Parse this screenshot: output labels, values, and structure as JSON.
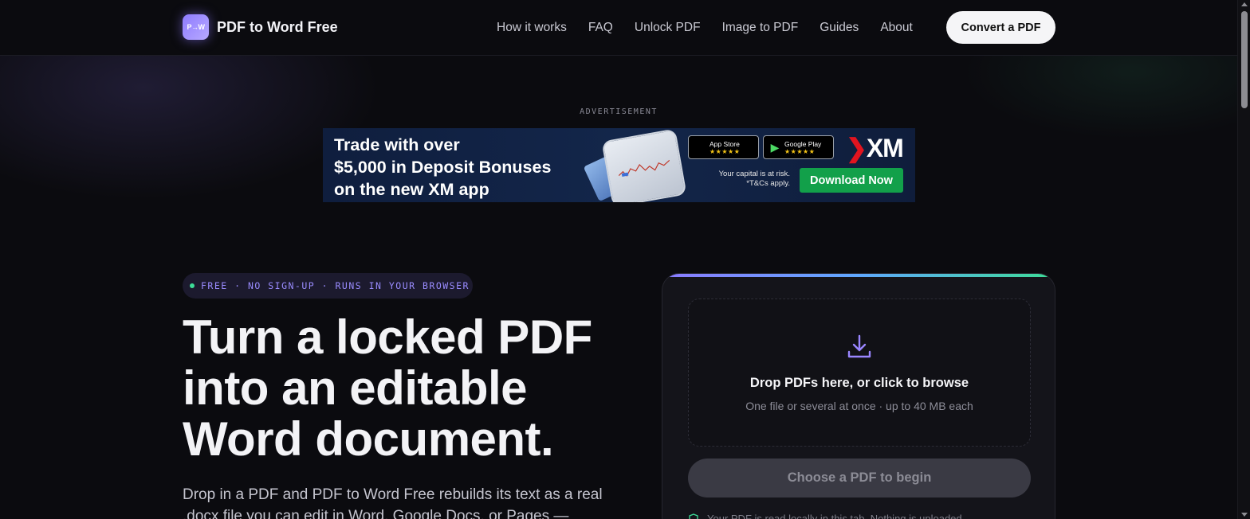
{
  "header": {
    "logo_mark": "P→W",
    "logo_text": "PDF to Word Free",
    "nav": [
      "How it works",
      "FAQ",
      "Unlock PDF",
      "Image to PDF",
      "Guides",
      "About"
    ],
    "cta_label": "Convert a PDF"
  },
  "ad": {
    "label": "ADVERTISEMENT",
    "headline_lines": [
      "Trade with over",
      "$5,000 in Deposit Bonuses",
      "on the new XM app"
    ],
    "app_store": {
      "label": "App Store",
      "stars": "★★★★★",
      "icon": "apple-icon"
    },
    "google_play": {
      "label": "Google Play",
      "stars": "★★★★★",
      "icon": "google-play-icon"
    },
    "brand": "XM",
    "risk_lines": [
      "Your capital is at risk.",
      "*T&Cs apply."
    ],
    "button_label": "Download Now"
  },
  "hero": {
    "pill": "FREE · NO SIGN-UP · RUNS IN YOUR BROWSER",
    "title_lines": [
      "Turn a locked PDF",
      "into an editable",
      "Word document."
    ],
    "subtitle": "Drop in a PDF and PDF to Word Free rebuilds its text as a real .docx file you can edit in Word, Google Docs, or Pages —"
  },
  "upload": {
    "dropzone_title": "Drop PDFs here, or click to browse",
    "dropzone_sub": "One file or several at once · up to 40 MB each",
    "button_label": "Choose a PDF to begin",
    "privacy_note": "Your PDF is read locally in this tab. Nothing is uploaded."
  },
  "colors": {
    "background": "#0b0b0f",
    "accent": "#8b7bff",
    "accent_green": "#3ddc97",
    "ad_button": "#12a04a"
  }
}
